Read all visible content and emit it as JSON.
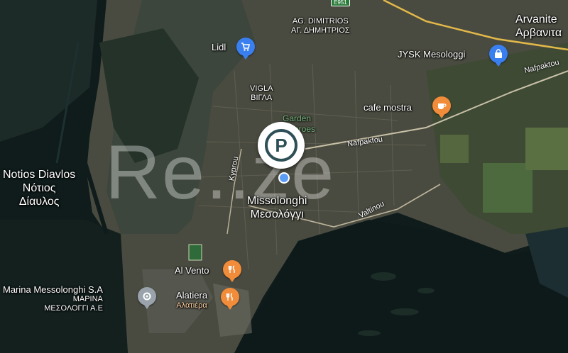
{
  "places": {
    "notios_latin": "Notios Diavlos",
    "notios_greek_1": "Νότιος",
    "notios_greek_2": "Δίαυλος",
    "lidl": "Lidl",
    "ag_dimitrios_latin": "AG. DIMITRIOS",
    "ag_dimitrios_greek": "ΑΓ. ΔΗΜΗΤΡΙΟΣ",
    "vigla_latin": "VIGLA",
    "vigla_greek": "ΒΙΓΛΑ",
    "garden_1": "Garden",
    "garden_2": "of Heroes",
    "missolonghi_latin": "Missolonghi",
    "missolonghi_greek": "Μεσολόγγι",
    "arvanites_latin": "Arvanite",
    "arvanites_greek": "Αρβανιτα",
    "jysk": "JYSK Mesologgi",
    "cafe_mostra": "cafe mostra",
    "al_vento": "Al Vento",
    "alatiera_latin": "Alatiera",
    "alatiera_greek": "Αλατιέρα",
    "marina_latin": "Marina Messolonghi S.A",
    "marina_greek_1": "ΜΑΡΙΝΑ",
    "marina_greek_2": "ΜΕΣΟΛΟΓΓΙ Α.Ε"
  },
  "roads": {
    "kyprou": "Kyprou",
    "nafpaktou_1": "Nafpaktou",
    "nafpaktou_2": "Nafpaktou",
    "valtinou": "Valtinou",
    "e951": "E951"
  },
  "icons": {
    "parking": "parking-icon",
    "lidl": "shopping-cart-icon",
    "jysk": "shopping-bag-icon",
    "cafe": "coffee-icon",
    "restaurant": "restaurant-icon",
    "marina": "marina-icon"
  },
  "watermark": "Re..ze",
  "colors": {
    "water": "#0f1c1b",
    "land": "#4a4c3f",
    "shop": "#3a7ff0",
    "food": "#f08c3a"
  }
}
